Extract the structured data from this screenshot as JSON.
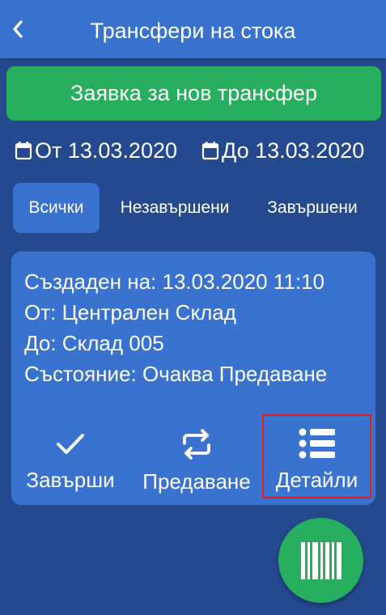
{
  "header": {
    "title": "Трансфери на стока",
    "back_icon": "chevron-left-icon"
  },
  "new_transfer_button": "Заявка за нов трансфер",
  "date_filter": {
    "from": "От 13.03.2020",
    "to": "До 13.03.2020"
  },
  "tabs": [
    {
      "label": "Всички",
      "active": true
    },
    {
      "label": "Незавършени",
      "active": false
    },
    {
      "label": "Завършени",
      "active": false
    }
  ],
  "transfer": {
    "created": "Създаден на: 13.03.2020 11:10",
    "from": "От: Централен Склад",
    "to": "До: Склад 005",
    "status": "Състояние: Очаква Предаване",
    "actions": {
      "complete": "Завърши",
      "handover": "Предаване",
      "details": "Детайли"
    }
  },
  "fab": {
    "icon": "barcode-icon"
  },
  "colors": {
    "background": "#24498f",
    "panel": "#3a72cf",
    "accent_green": "#27ae5e",
    "highlight_red": "#e01e1e"
  }
}
